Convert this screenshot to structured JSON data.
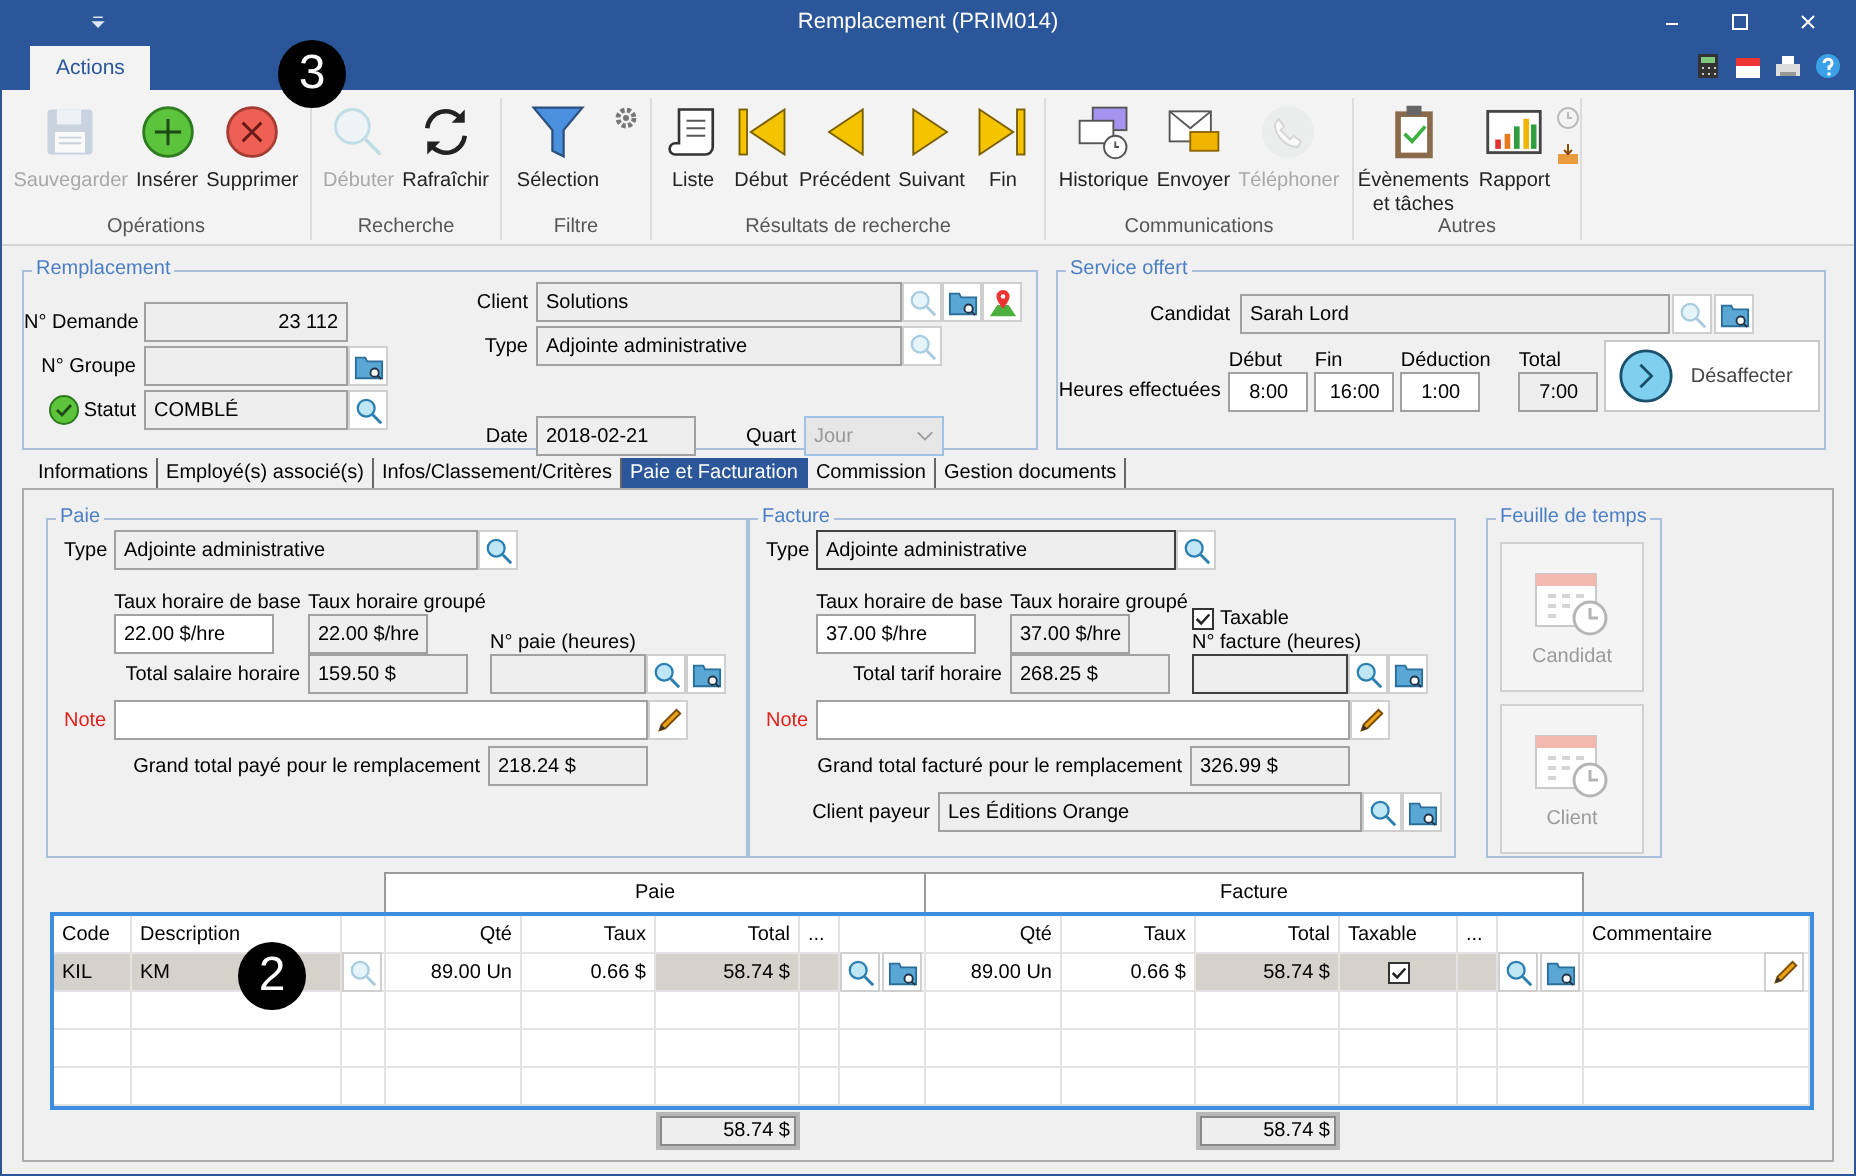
{
  "window": {
    "title": "Remplacement (PRIM014)"
  },
  "ribbon": {
    "tabs": [
      {
        "label": "Actions",
        "selected": true
      }
    ],
    "callout": "3",
    "groups": [
      {
        "label": "Opérations",
        "buttons": [
          {
            "label": "Sauvegarder",
            "kind": "save",
            "disabled": true
          },
          {
            "label": "Insérer",
            "kind": "add",
            "disabled": false
          },
          {
            "label": "Supprimer",
            "kind": "delete",
            "disabled": false
          }
        ]
      },
      {
        "label": "Recherche",
        "buttons": [
          {
            "label": "Débuter",
            "kind": "search",
            "disabled": true
          },
          {
            "label": "Rafraîchir",
            "kind": "refresh",
            "disabled": false
          }
        ]
      },
      {
        "label": "Filtre",
        "buttons": [
          {
            "label": "Sélection",
            "kind": "filter",
            "disabled": false
          }
        ]
      },
      {
        "label": "Résultats de recherche",
        "buttons": [
          {
            "label": "Liste",
            "kind": "list",
            "disabled": false
          },
          {
            "label": "Début",
            "kind": "first",
            "disabled": false
          },
          {
            "label": "Précédent",
            "kind": "prev",
            "disabled": false
          },
          {
            "label": "Suivant",
            "kind": "next",
            "disabled": false
          },
          {
            "label": "Fin",
            "kind": "last",
            "disabled": false
          }
        ]
      },
      {
        "label": "Communications",
        "buttons": [
          {
            "label": "Historique",
            "kind": "history",
            "disabled": false
          },
          {
            "label": "Envoyer",
            "kind": "send",
            "disabled": false
          },
          {
            "label": "Téléphoner",
            "kind": "phone",
            "disabled": true
          }
        ]
      },
      {
        "label": "Autres",
        "buttons": [
          {
            "label": "Évènements et tâches",
            "kind": "tasks",
            "disabled": false
          },
          {
            "label": "Rapport",
            "kind": "report",
            "disabled": false
          }
        ]
      }
    ]
  },
  "remplacement": {
    "legend": "Remplacement",
    "demande": {
      "label": "N° Demande",
      "value": "23 112"
    },
    "groupe": {
      "label": "N° Groupe"
    },
    "statut": {
      "label": "Statut",
      "value": "COMBLÉ"
    },
    "client": {
      "label": "Client",
      "value": "Solutions"
    },
    "type": {
      "label": "Type",
      "value": "Adjointe administrative"
    },
    "date": {
      "label": "Date",
      "value": "2018-02-21"
    },
    "quart": {
      "label": "Quart",
      "value": "Jour",
      "disabled": true
    }
  },
  "service": {
    "legend": "Service offert",
    "candidat": {
      "label": "Candidat",
      "value": "Sarah Lord"
    },
    "hours_label": "Heures effectuées",
    "hours": [
      {
        "label": "Début",
        "value": "8:00",
        "readonly": false
      },
      {
        "label": "Fin",
        "value": "16:00",
        "readonly": false
      },
      {
        "label": "Déduction",
        "value": "1:00",
        "readonly": false
      },
      {
        "label": "Total",
        "value": "7:00",
        "readonly": true
      }
    ],
    "button": "Désaffecter"
  },
  "tabs": [
    {
      "label": "Informations",
      "selected": false
    },
    {
      "label": "Employé(s) associé(s)",
      "selected": false
    },
    {
      "label": "Infos/Classement/Critères",
      "selected": false
    },
    {
      "label": "Paie et Facturation",
      "selected": true
    },
    {
      "label": "Commission",
      "selected": false
    },
    {
      "label": "Gestion documents",
      "selected": false
    }
  ],
  "paie": {
    "legend": "Paie",
    "type_label": "Type",
    "type_value": "Adjointe administrative",
    "base_label": "Taux horaire de base",
    "base_value": "22.00 $/hre",
    "group_label": "Taux horaire groupé",
    "group_value": "22.00 $/hre",
    "number_label": "N° paie (heures)",
    "total_label": "Total salaire horaire",
    "total_value": "159.50 $",
    "note_label": "Note",
    "grand_label": "Grand total payé pour le remplacement",
    "grand_value": "218.24 $"
  },
  "facture": {
    "legend": "Facture",
    "type_label": "Type",
    "type_value": "Adjointe administrative",
    "base_label": "Taux horaire de base",
    "base_value": "37.00 $/hre",
    "group_label": "Taux horaire groupé",
    "group_value": "37.00 $/hre",
    "taxable": {
      "label": "Taxable",
      "checked": true
    },
    "number_label": "N° facture (heures)",
    "total_label": "Total tarif horaire",
    "total_value": "268.25 $",
    "note_label": "Note",
    "grand_label": "Grand total facturé pour le remplacement",
    "grand_value": "326.99 $",
    "payer_label": "Client payeur",
    "payer_value": "Les Éditions Orange"
  },
  "timesheet": {
    "legend": "Feuille de temps",
    "buttons": [
      {
        "label": "Candidat",
        "disabled": true
      },
      {
        "label": "Client",
        "disabled": true
      }
    ]
  },
  "table": {
    "callout": "2",
    "groups": [
      {
        "label": "Paie"
      },
      {
        "label": "Facture"
      }
    ],
    "columns": [
      {
        "label": "Code",
        "kind": "text",
        "shaded": true
      },
      {
        "label": "Description",
        "kind": "text",
        "shaded": true
      },
      {
        "kind": "search",
        "shaded": false
      },
      {
        "label": "Qté",
        "kind": "num",
        "shaded": false
      },
      {
        "label": "Taux",
        "kind": "num",
        "shaded": false
      },
      {
        "label": "Total",
        "kind": "num",
        "shaded": true
      },
      {
        "label": "...",
        "kind": "ellipsis",
        "shaded": true
      },
      {
        "kind": "lookup",
        "shaded": false
      },
      {
        "label": "Qté",
        "kind": "num",
        "shaded": false
      },
      {
        "label": "Taux",
        "kind": "num",
        "shaded": false
      },
      {
        "label": "Total",
        "kind": "num",
        "shaded": true
      },
      {
        "label": "Taxable",
        "kind": "check",
        "shaded": true
      },
      {
        "label": "...",
        "kind": "ellipsis",
        "shaded": true
      },
      {
        "kind": "lookup",
        "shaded": false
      },
      {
        "label": "Commentaire",
        "kind": "comment",
        "shaded": false
      }
    ],
    "rows": [
      {
        "values": [
          "KIL",
          "KM",
          "89.00 Un",
          "0.66 $",
          "58.74 $",
          "89.00 Un",
          "0.66 $",
          "58.74 $"
        ],
        "taxable": true
      }
    ],
    "paie_total": "58.74 $",
    "facture_total": "58.74 $"
  }
}
